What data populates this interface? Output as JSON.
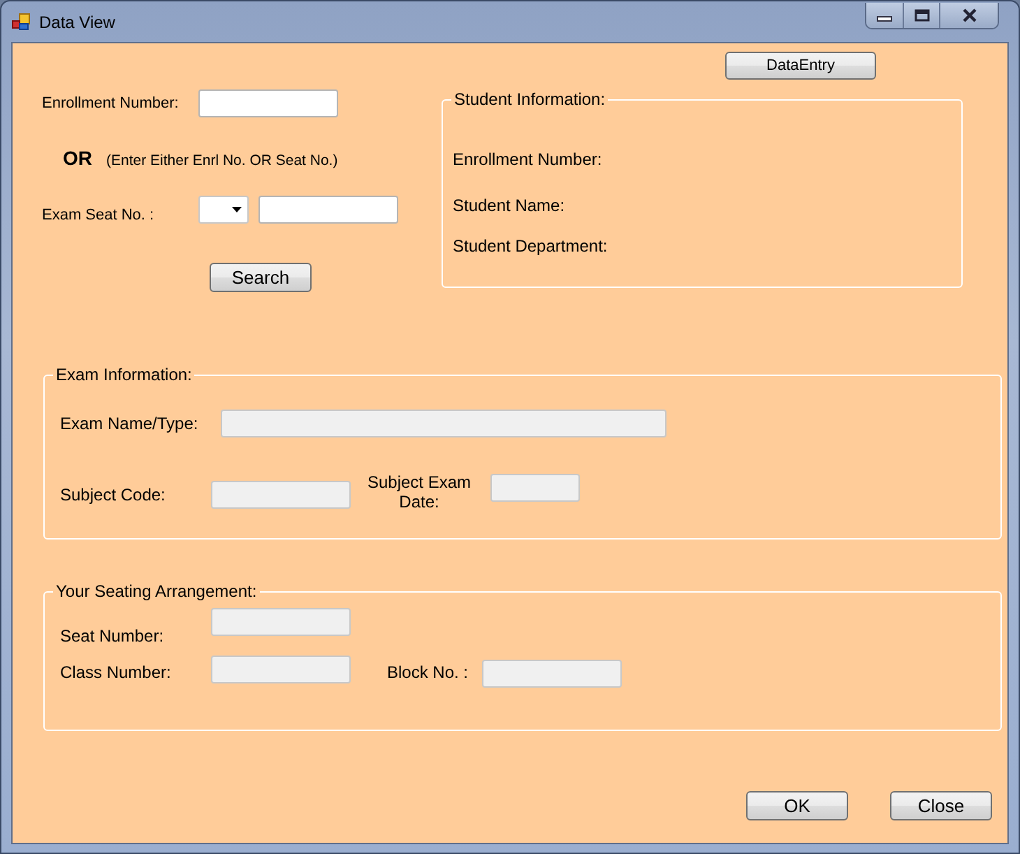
{
  "window": {
    "title": "Data View"
  },
  "data_entry_button": "DataEntry",
  "search": {
    "enrollment_label": "Enrollment Number:",
    "enrollment_field": {
      "disabled": false
    },
    "or_label": "OR",
    "hint": "(Enter Either Enrl No. OR Seat No.)",
    "seat_label": "Exam Seat No. :",
    "seat_field": {
      "disabled": false
    },
    "button": "Search"
  },
  "student_info": {
    "title": "Student Information:",
    "labels": [
      "Enrollment Number:",
      "Student Name:",
      "Student Department:"
    ]
  },
  "exam_info": {
    "title": "Exam Information:",
    "fields": [
      {
        "label": "Exam Name/Type:",
        "disabled": true
      },
      {
        "label": "Subject Code:",
        "disabled": true
      },
      {
        "label": "Subject Exam Date:",
        "disabled": true
      }
    ]
  },
  "seating": {
    "title": "Your Seating Arrangement:",
    "fields": [
      {
        "label": "Seat Number:",
        "disabled": true
      },
      {
        "label": "Class Number:",
        "disabled": true
      },
      {
        "label": "Block No. :",
        "disabled": true
      }
    ]
  },
  "buttons": [
    "OK",
    "Close"
  ]
}
